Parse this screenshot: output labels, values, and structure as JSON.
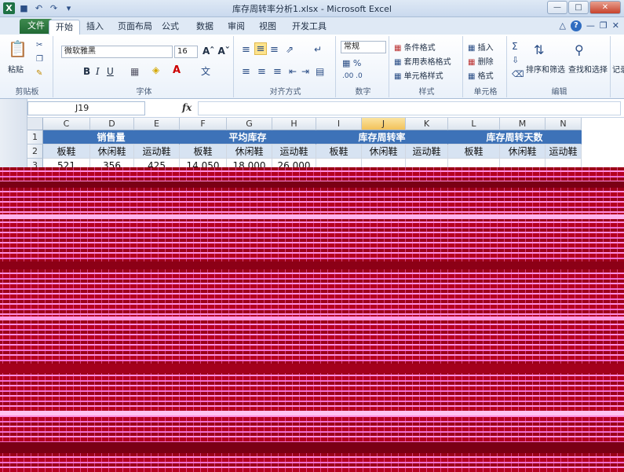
{
  "window": {
    "title": "库存周转率分析1.xlsx - Microsoft Excel",
    "app_icon": "X"
  },
  "tabs": {
    "file": "文件",
    "items": [
      "开始",
      "插入",
      "页面布局",
      "公式",
      "数据",
      "审阅",
      "视图",
      "开发工具"
    ]
  },
  "ribbon": {
    "clipboard": {
      "paste": "粘贴",
      "label": "剪贴板"
    },
    "font": {
      "name": "微软雅黑",
      "size": "16",
      "label": "字体"
    },
    "alignment": {
      "label": "对齐方式"
    },
    "number": {
      "format": "常规",
      "label": "数字"
    },
    "styles": {
      "conditional": "条件格式",
      "table": "套用表格格式",
      "cell": "单元格样式",
      "label": "样式"
    },
    "cells": {
      "insert": "插入",
      "delete": "删除",
      "format": "格式",
      "label": "单元格"
    },
    "editing": {
      "sort": "排序和筛选",
      "find": "查找和选择",
      "label": "编辑"
    },
    "extra": {
      "record": "记录"
    }
  },
  "formula_bar": {
    "name_box": "J19",
    "fx": "fx",
    "formula": ""
  },
  "sheet": {
    "columns": [
      "C",
      "D",
      "E",
      "F",
      "G",
      "H",
      "I",
      "J",
      "K",
      "L",
      "M",
      "N"
    ],
    "selected_column": "J",
    "rows": [
      "1",
      "2",
      "3"
    ],
    "group_headers": [
      "销售量",
      "平均库存",
      "库存周转率",
      "库存周转天数"
    ],
    "subheaders": [
      "板鞋",
      "休闲鞋",
      "运动鞋",
      "板鞋",
      "休闲鞋",
      "运动鞋",
      "板鞋",
      "休闲鞋",
      "运动鞋",
      "板鞋",
      "休闲鞋",
      "运动鞋"
    ],
    "row3": [
      "521",
      "356",
      "425",
      "14,050",
      "18,000",
      "26,000",
      "",
      "",
      "",
      "",
      "",
      ""
    ]
  },
  "colors": {
    "header_blue": "#3d72b8",
    "subheader_blue": "#d7e3f2",
    "glitch_red": "#b5001f",
    "glitch_pink": "#ff8ee0"
  }
}
